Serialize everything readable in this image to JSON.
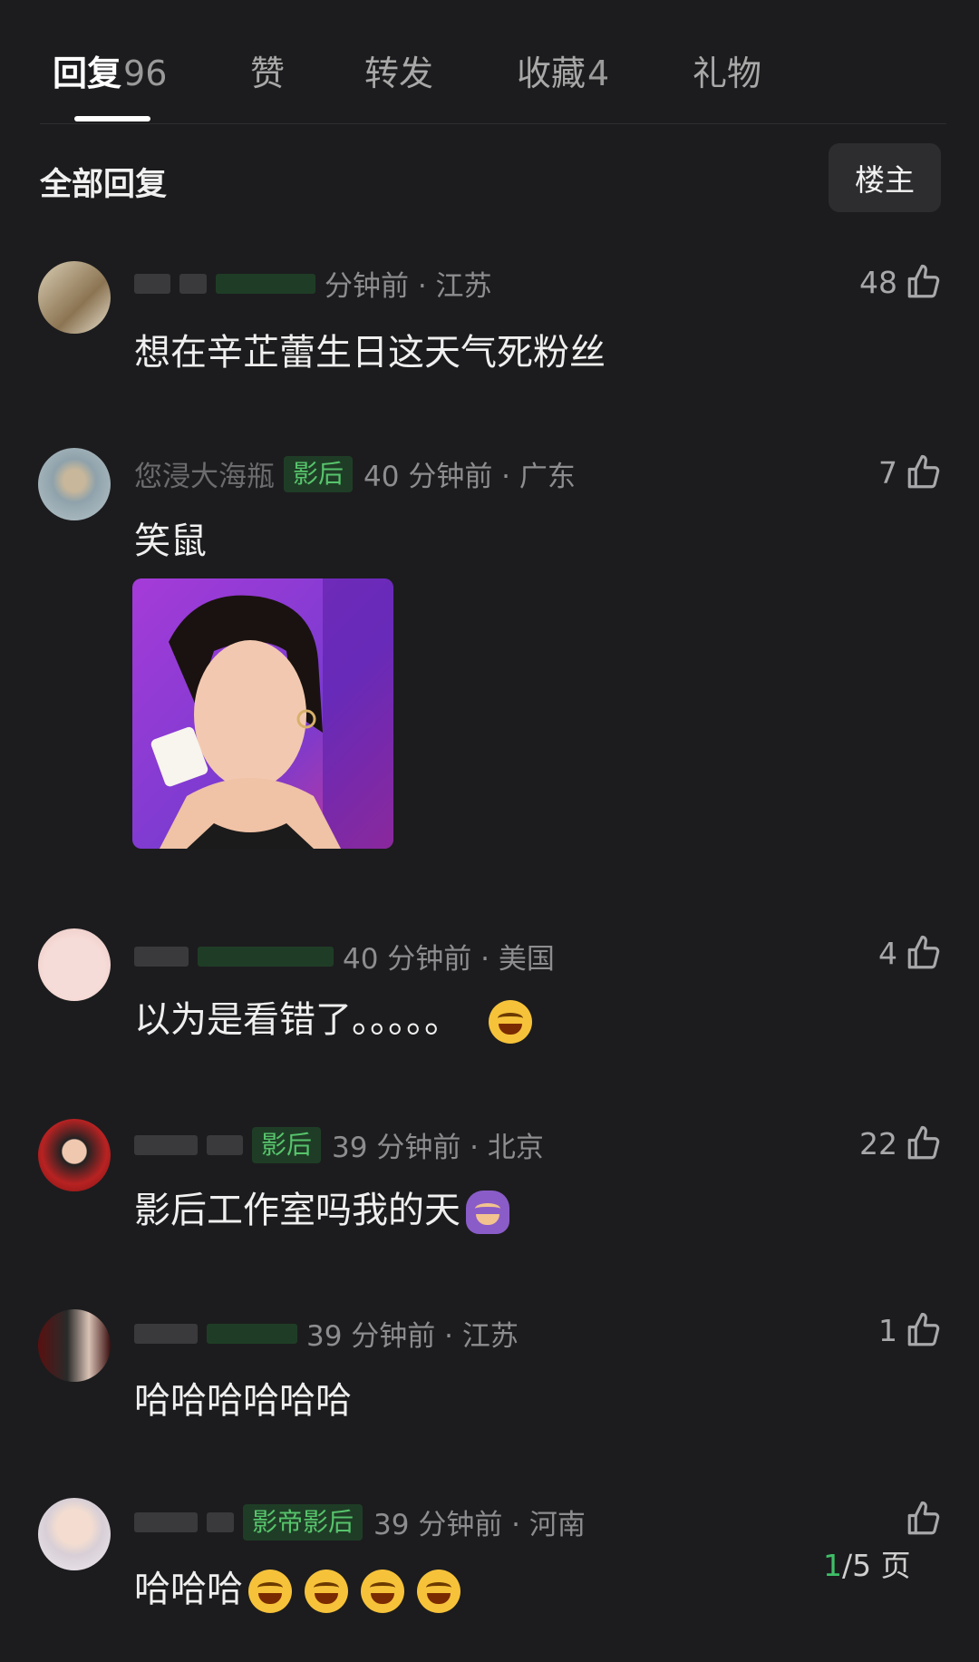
{
  "tabs": {
    "reply": {
      "label": "回复",
      "count": "96"
    },
    "like": {
      "label": "赞"
    },
    "repost": {
      "label": "转发"
    },
    "favorite": {
      "label": "收藏",
      "count": "4"
    },
    "gift": {
      "label": "礼物"
    }
  },
  "filter": {
    "label": "全部回复",
    "op_button": "楼主"
  },
  "comments": [
    {
      "name": "",
      "badge": "",
      "meta": "分钟前 · 江苏",
      "text": "想在辛芷蕾生日这天气死粉丝",
      "likes": "48"
    },
    {
      "name": "您浸大海瓶",
      "badge": "影后",
      "meta": "40 分钟前 · 广东",
      "text": "笑鼠",
      "likes": "7"
    },
    {
      "name": "",
      "badge": "",
      "meta": "40 分钟前 · 美国",
      "text": "以为是看错了。。。。。",
      "likes": "4"
    },
    {
      "name": "",
      "badge": "影后",
      "meta": "39 分钟前 · 北京",
      "text": "影后工作室吗我的天",
      "likes": "22"
    },
    {
      "name": "",
      "badge": "",
      "meta": "39 分钟前 · 江苏",
      "text": "哈哈哈哈哈哈",
      "likes": "1"
    },
    {
      "name": "",
      "badge": "影帝影后",
      "meta": "39 分钟前 · 河南",
      "text": "哈哈哈",
      "likes": ""
    }
  ],
  "pager": {
    "current": "1",
    "total_text": "/5 页"
  },
  "colors": {
    "background": "#1c1c1e",
    "badge_green": "#57c46c",
    "pager_green": "#3fbf68"
  }
}
